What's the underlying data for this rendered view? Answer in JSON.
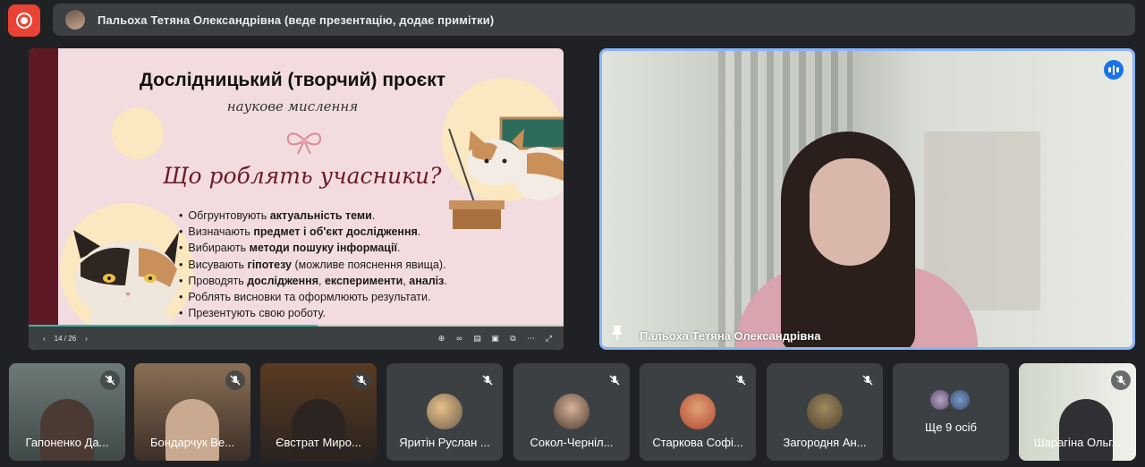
{
  "presenter_bar": {
    "text": "Пальоха Тетяна Олександрівна (веде презентацію, додає примітки)"
  },
  "slide": {
    "title": "Дослідницький (творчий) проєкт",
    "subtitle": "наукове мислення",
    "heading": "Що роблять учасники?",
    "bullets": [
      {
        "pre": "Обгрунтовують ",
        "bold": "актуальність теми",
        "post": "."
      },
      {
        "pre": "Визначають ",
        "bold": "предмет і об'єкт дослідження",
        "post": "."
      },
      {
        "pre": "Вибирають ",
        "bold": "методи пошуку інформації",
        "post": "."
      },
      {
        "pre": "Висувають ",
        "bold": "гіпотезу",
        "post": " (можливе пояснення явища)."
      },
      {
        "pre": "Проводять ",
        "bold": "дослідження",
        "post": ", "
      },
      {
        "pre": "Роблять висновки та оформлюють результати.",
        "bold": "",
        "post": ""
      },
      {
        "pre": "Презентують свою роботу.",
        "bold": "",
        "post": ""
      }
    ],
    "bullet5_extra": {
      "bold2": "експерименти",
      "sep": ", ",
      "bold3": "аналіз",
      "end": "."
    },
    "page_indicator": "14 / 26",
    "progress": 0.54
  },
  "main_video": {
    "name": "Пальоха Тетяна Олександрівна"
  },
  "participants": [
    {
      "name": "Гапоненко Да..."
    },
    {
      "name": "Бондарчук Ве..."
    },
    {
      "name": "Євстрат Миро..."
    },
    {
      "name": "Яритін Руслан ..."
    },
    {
      "name": "Сокол-Черніл..."
    },
    {
      "name": "Старкова Софі..."
    },
    {
      "name": "Загородня Ан..."
    },
    {
      "name": "Ще 9 осіб"
    },
    {
      "name": "Шарагіна Ольг..."
    }
  ],
  "colors": {
    "accent": "#8ab4f8",
    "record": "#ea4335",
    "tile": "#3c4043",
    "background": "#202124"
  }
}
